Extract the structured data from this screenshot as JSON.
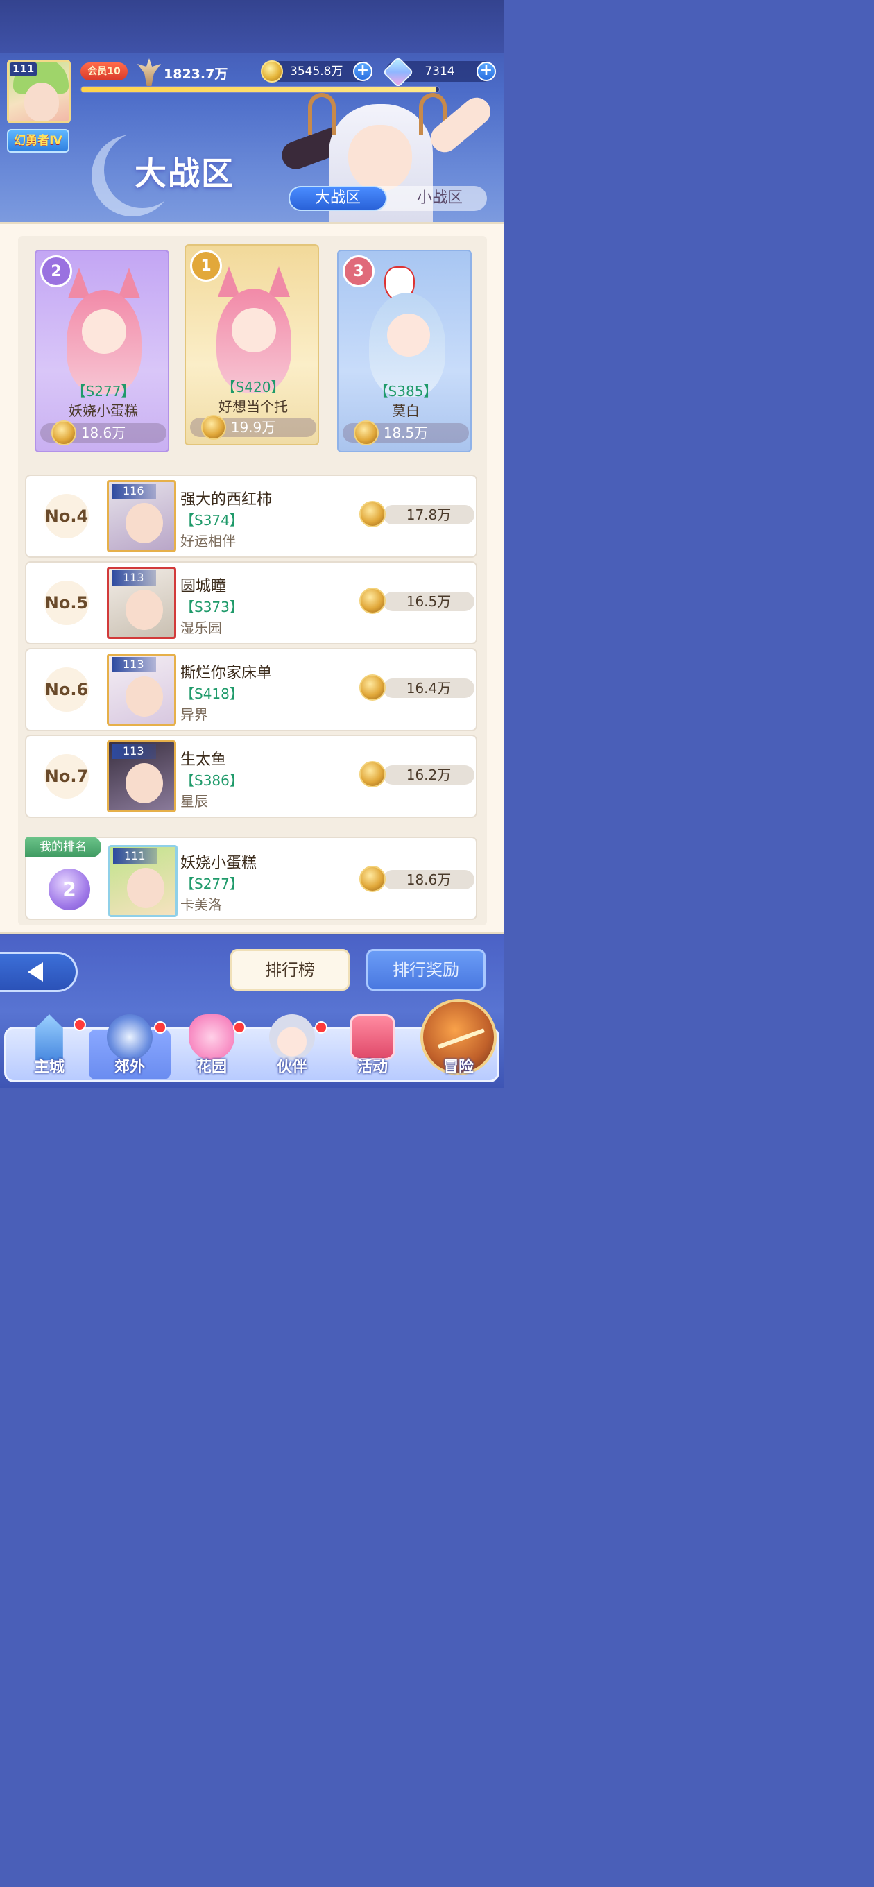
{
  "player": {
    "level": "111",
    "title": "幻勇者Ⅳ",
    "vip": "会员10",
    "power": "1823.7万",
    "exp_fraction": 0.99
  },
  "resources": {
    "gold": "3545.8万",
    "gems": "7314"
  },
  "page": {
    "title": "大战区"
  },
  "tabs": [
    {
      "label": "大战区",
      "selected": true
    },
    {
      "label": "小战区",
      "selected": false
    }
  ],
  "podium": [
    {
      "rank": "2",
      "server": "【S277】",
      "name": "妖娆小蛋糕",
      "score": "18.6万"
    },
    {
      "rank": "1",
      "server": "【S420】",
      "name": "好想当个托",
      "score": "19.9万"
    },
    {
      "rank": "3",
      "server": "【S385】",
      "name": "莫白",
      "score": "18.5万"
    }
  ],
  "ranking": [
    {
      "rank": "No.4",
      "level": "116",
      "name": "强大的西红柿",
      "server": "【S374】",
      "sub": "好运相伴",
      "score": "17.8万"
    },
    {
      "rank": "No.5",
      "level": "113",
      "name": "圆城瞳",
      "server": "【S373】",
      "sub": "湿乐园",
      "score": "16.5万"
    },
    {
      "rank": "No.6",
      "level": "113",
      "name": "撕烂你家床单",
      "server": "【S418】",
      "sub": "异界",
      "score": "16.4万"
    },
    {
      "rank": "No.7",
      "level": "113",
      "name": "生太鱼",
      "server": "【S386】",
      "sub": "星辰",
      "score": "16.2万"
    }
  ],
  "my_rank": {
    "tag": "我的排名",
    "rank": "2",
    "level": "111",
    "name": "妖娆小蛋糕",
    "server": "【S277】",
    "sub": "卡美洛",
    "score": "18.6万"
  },
  "buttons": {
    "leaderboard": "排行榜",
    "rewards": "排行奖励"
  },
  "nav": [
    {
      "label": "主城",
      "icon": "castle-icon",
      "badge": true
    },
    {
      "label": "郊外",
      "icon": "portal-icon",
      "badge": true,
      "selected": true
    },
    {
      "label": "花园",
      "icon": "heart-garden-icon",
      "badge": true
    },
    {
      "label": "伙伴",
      "icon": "partner-icon",
      "badge": true
    },
    {
      "label": "活动",
      "icon": "gift-icon",
      "badge": false
    },
    {
      "label": "冒险",
      "icon": "compass-icon",
      "badge": false
    }
  ],
  "colors": {
    "accent_blue": "#2a62d8",
    "server_green": "#1f9a6a",
    "badge_red": "#ff3a3a",
    "gold": "#e1a83a"
  }
}
